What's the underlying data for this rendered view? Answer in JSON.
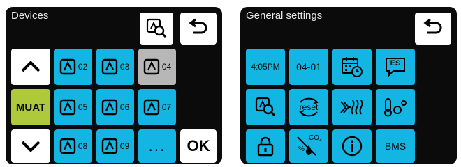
{
  "left_panel": {
    "title": "Devices",
    "mute_label": "MUAT",
    "more_label": "...",
    "ok_label": "OK",
    "devices": [
      {
        "label": "02",
        "state": "active"
      },
      {
        "label": "03",
        "state": "active"
      },
      {
        "label": "04",
        "state": "disabled"
      },
      {
        "label": "05",
        "state": "active"
      },
      {
        "label": "06",
        "state": "active"
      },
      {
        "label": "07",
        "state": "active"
      },
      {
        "label": "08",
        "state": "active"
      },
      {
        "label": "09",
        "state": "active"
      }
    ],
    "icons": {
      "search": "device-search-icon",
      "back": "back-arrow-icon",
      "up": "chevron-up-icon",
      "down": "chevron-down-icon",
      "device": "fan-unit-icon"
    }
  },
  "right_panel": {
    "title": "General settings",
    "time_label": "4:05PM",
    "date_label": "04-01",
    "language_label": "ES",
    "reset_label": "reset",
    "co2_label": "CO₂",
    "bms_label": "BMS",
    "icons": {
      "back": "back-arrow-icon",
      "schedule": "calendar-clock-icon",
      "language": "language-icon",
      "search": "device-search-icon",
      "reset": "reset-icon",
      "heater": "heater-icon",
      "sensors": "temperature-sensor-icon",
      "lock": "lock-icon",
      "co2": "co2-humidity-icon",
      "info": "info-icon"
    }
  },
  "colors": {
    "panel": "#0b0b0b",
    "button": "#13b5e3",
    "mute": "#aec93a",
    "disabled": "#b7b7b7",
    "white": "#ffffff"
  }
}
